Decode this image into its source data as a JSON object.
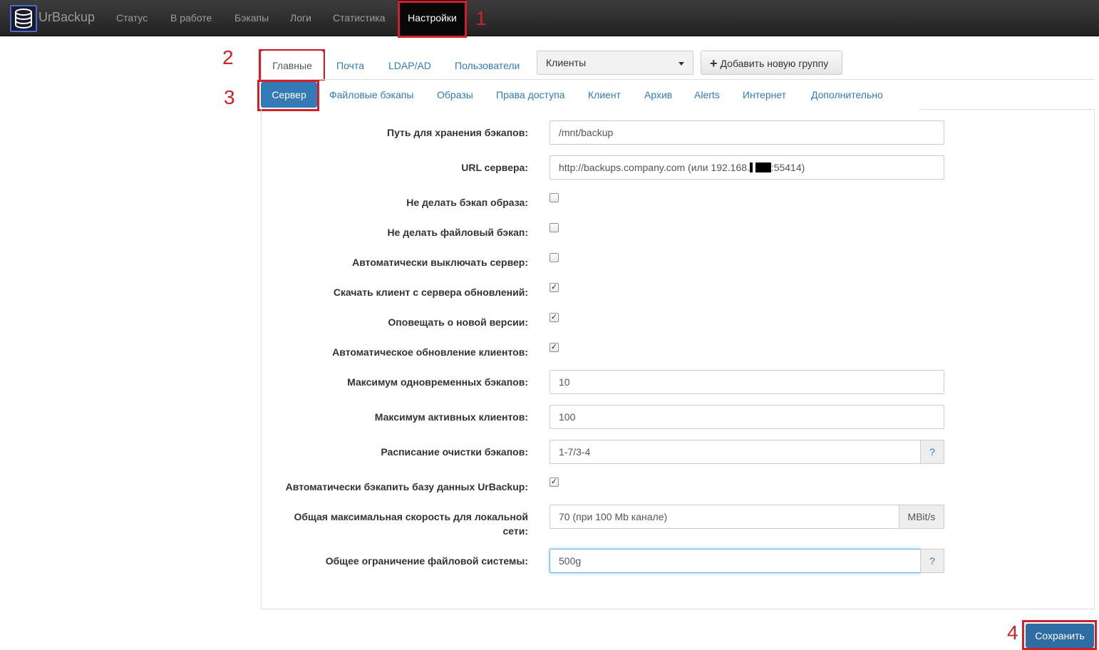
{
  "navbar": {
    "brand": "UrBackup",
    "items": [
      "Статус",
      "В работе",
      "Бэкапы",
      "Логи",
      "Статистика",
      "Настройки"
    ]
  },
  "annotations": [
    "1",
    "2",
    "3",
    "4"
  ],
  "tabs": {
    "top": [
      "Главные",
      "Почта",
      "LDAP/AD",
      "Пользователи"
    ],
    "group_select": "Клиенты",
    "add_group": "Добавить новую группу",
    "sub": [
      "Сервер",
      "Файловые бэкапы",
      "Образы",
      "Права доступа",
      "Клиент",
      "Архив",
      "Alerts",
      "Интернет",
      "Дополнительно"
    ]
  },
  "form": {
    "backup_path": {
      "label": "Путь для хранения бэкапов:",
      "value": "/mnt/backup"
    },
    "server_url": {
      "label": "URL сервера:",
      "value_a": "http://backups.company.com (или 192.168.",
      "value_b": ":55414)"
    },
    "no_image_backup": {
      "label": "Не делать бэкап образа:",
      "checked": false
    },
    "no_file_backup": {
      "label": "Не делать файловый бэкап:",
      "checked": false
    },
    "auto_shutdown": {
      "label": "Автоматически выключать сервер:",
      "checked": false
    },
    "download_client": {
      "label": "Скачать клиент с сервера обновлений:",
      "checked": true
    },
    "notify_version": {
      "label": "Оповещать о новой версии:",
      "checked": true
    },
    "auto_update_clients": {
      "label": "Автоматическое обновление клиентов:",
      "checked": true
    },
    "max_simultaneous": {
      "label": "Максимум одновременных бэкапов:",
      "value": "10"
    },
    "max_active_clients": {
      "label": "Максимум активных клиентов:",
      "value": "100"
    },
    "cleanup_schedule": {
      "label": "Расписание очистки бэкапов:",
      "value": "1-7/3-4",
      "help": "?"
    },
    "backup_db": {
      "label": "Автоматически бэкапить базу данных UrBackup:",
      "checked": true
    },
    "max_speed": {
      "label": "Общая максимальная скорость для локальной сети:",
      "value": "70 (при 100 Mb канале)",
      "unit": "MBit/s"
    },
    "fs_limit": {
      "label": "Общее ограничение файловой системы:",
      "value": "500g",
      "help": "?"
    }
  },
  "save_button": "Сохранить",
  "colors": {
    "accent": "#337ab7",
    "annotation": "#d0202a",
    "navbar": "#222222"
  }
}
